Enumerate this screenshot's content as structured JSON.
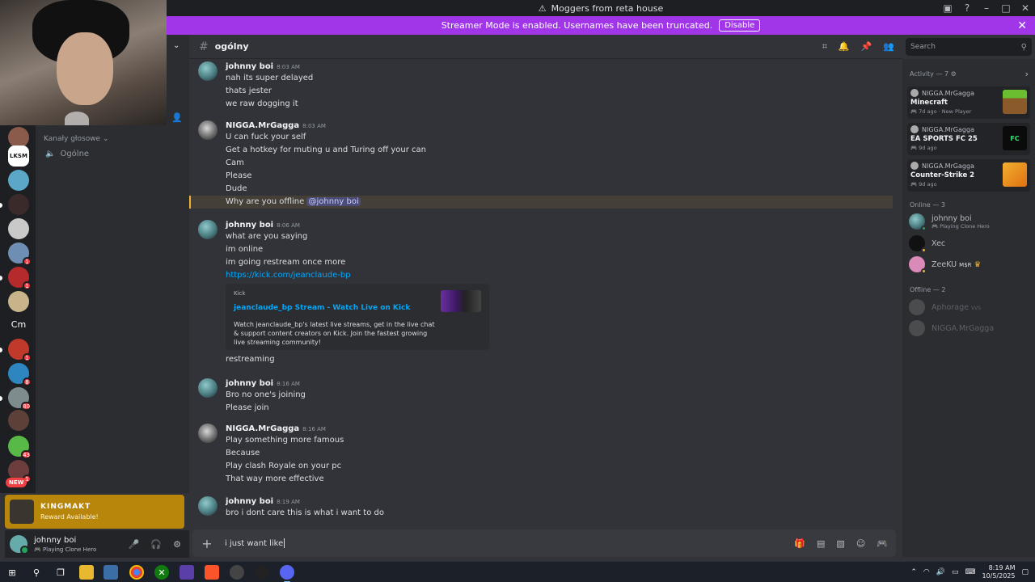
{
  "window": {
    "title": "Moggers from reta house"
  },
  "banner": {
    "text": "Streamer Mode is enabled. Usernames have been truncated.",
    "disable_label": "Disable"
  },
  "channel_sidebar": {
    "category": "Kanały głosowe",
    "voice_channel": "Ogólne"
  },
  "server_rail": {
    "labels": [
      "LKSM",
      "Cm"
    ],
    "badges": [
      "1",
      "1",
      "1",
      "8",
      "80",
      "43",
      "1"
    ],
    "new_label": "NEW"
  },
  "notification": {
    "title": "KINGMAKT",
    "subtitle": "Reward Available!"
  },
  "user_panel": {
    "name": "johnny boi",
    "status": "Playing Clone Hero"
  },
  "header": {
    "channel_name": "ogólny"
  },
  "search": {
    "placeholder": "Search"
  },
  "messages": [
    {
      "author": "johnny boi",
      "time": "8:03 AM",
      "lines": [
        "nah its super delayed",
        "thats jester",
        "we raw dogging it"
      ]
    },
    {
      "author": "NIGGA.MrGagga",
      "time": "8:03 AM",
      "lines": [
        "U can fuck your self",
        "Get a hotkey for muting u and Turing off your can",
        "Cam",
        "Please",
        "Dude"
      ],
      "mention_line_prefix": "Why are you offline ",
      "mention": "@johnny boi"
    },
    {
      "author": "johnny boi",
      "time": "8:06 AM",
      "lines": [
        "what are you saying",
        "im online",
        "im going restream once more"
      ],
      "link": "https://kick.com/jeanclaude-bp",
      "embed": {
        "provider": "Kick",
        "title": "jeanclaude_bp Stream - Watch Live on Kick",
        "description": "Watch jeanclaude_bp's latest live streams, get in the live chat & support content creators on Kick. Join the fastest growing live streaming community!"
      },
      "after_embed": "restreaming"
    },
    {
      "author": "johnny boi",
      "time": "8:16 AM",
      "lines": [
        "Bro no one's joining",
        "Please join"
      ]
    },
    {
      "author": "NIGGA.MrGagga",
      "time": "8:16 AM",
      "lines": [
        "Play something more famous",
        "Because",
        "Play clash Royale on your pc",
        "That way more effective"
      ]
    },
    {
      "author": "johnny boi",
      "time": "8:19 AM",
      "lines": [
        "bro i dont care this is what i want to do"
      ]
    }
  ],
  "composer": {
    "value": "i just want like"
  },
  "activity": {
    "header": "Activity — 7",
    "items": [
      {
        "user": "NIGGA.MrGagga",
        "game": "Minecraft",
        "ago": "7d ago",
        "extra": "New Player",
        "color": "#5b8c2a"
      },
      {
        "user": "NIGGA.MrGagga",
        "game": "EA SPORTS FC 25",
        "ago": "9d ago",
        "extra": "",
        "color": "#0b0b0b"
      },
      {
        "user": "NIGGA.MrGagga",
        "game": "Counter-Strike 2",
        "ago": "9d ago",
        "extra": "",
        "color": "#e6a020"
      }
    ]
  },
  "members": {
    "online_header": "Online — 3",
    "online": [
      {
        "name": "johnny boi",
        "sub": "Playing Clone Hero"
      },
      {
        "name": "Xec",
        "sub": ""
      },
      {
        "name": "ZeeKU",
        "sub": "",
        "tag": "M$R"
      }
    ],
    "offline_header": "Offline — 2",
    "offline": [
      {
        "name": "Aphorage",
        "tag": "VVS"
      },
      {
        "name": "NIGGA.MrGagga"
      }
    ]
  },
  "taskbar": {
    "time": "8:19 AM",
    "date": "10/5/2025"
  }
}
